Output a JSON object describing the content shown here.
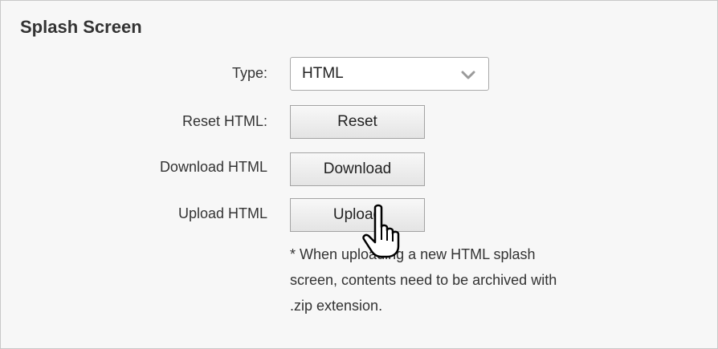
{
  "section": {
    "title": "Splash Screen"
  },
  "type_field": {
    "label": "Type:",
    "selected": "HTML",
    "icon": "chevron-down-icon"
  },
  "reset": {
    "label": "Reset HTML:",
    "button": "Reset"
  },
  "download": {
    "label": "Download HTML",
    "button": "Download"
  },
  "upload": {
    "label": "Upload HTML",
    "button": "Upload",
    "note_lines": [
      "* When uploading a new HTML splash",
      "screen, contents need to be archived with",
      ".zip extension."
    ]
  },
  "cursor": {
    "icon": "hand-pointer-icon"
  },
  "colors": {
    "panel_background": "#f7f7f7",
    "border": "#c8c8c8",
    "text": "#333333",
    "button_gradient_top": "#f8f8f8",
    "button_gradient_bottom": "#e4e4e4"
  }
}
